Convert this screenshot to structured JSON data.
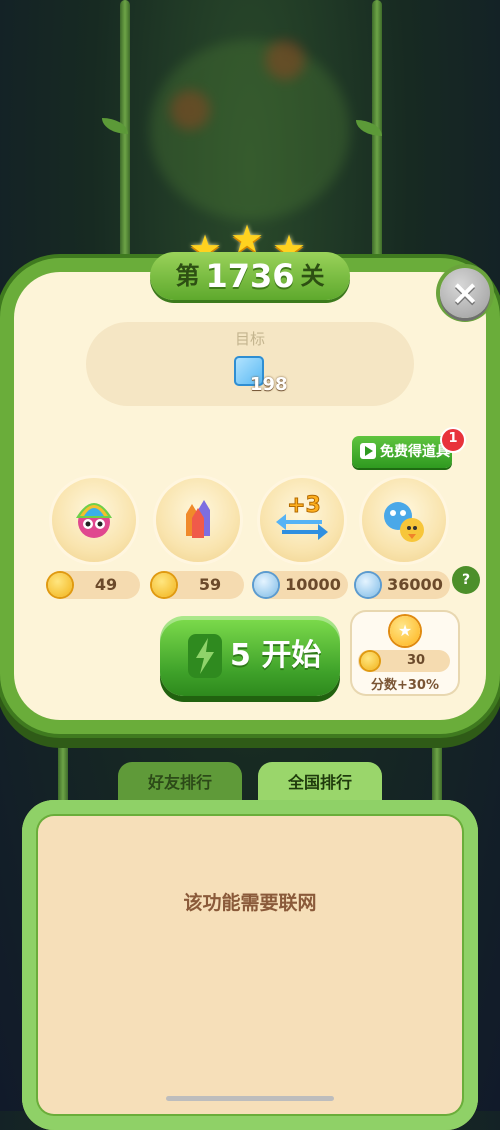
{
  "level": {
    "prefix": "第",
    "number": "1736",
    "suffix": "关",
    "stars": 3
  },
  "goal": {
    "label": "目标",
    "target_count": "198",
    "target_icon": "blue-block-icon"
  },
  "free_items": {
    "label": "免费得道具",
    "badge": "1"
  },
  "boosters": [
    {
      "name": "rainbow-owl",
      "icon": "rainbow-owl-icon",
      "currency": "coin",
      "price": "49"
    },
    {
      "name": "rockets",
      "icon": "rocket-icon",
      "currency": "coin",
      "price": "59"
    },
    {
      "name": "plus-moves",
      "icon": "plus-three-moves-icon",
      "icon_text": "+3",
      "currency": "gem",
      "price": "10000"
    },
    {
      "name": "critter-swap",
      "icon": "critter-icon",
      "currency": "gem",
      "price": "36000"
    }
  ],
  "start_button": {
    "lives": "5",
    "label": "开始"
  },
  "score_bonus": {
    "price": "30",
    "label": "分数+30%"
  },
  "help_label": "?",
  "close_label": "×",
  "leaderboard": {
    "tabs": [
      {
        "label": "好友排行",
        "active": false
      },
      {
        "label": "全国排行",
        "active": true
      }
    ],
    "message": "该功能需要联网"
  },
  "colors": {
    "panel": "#fdf4d8",
    "frame_green": "#6aad3a",
    "start_green": "#3fa22a",
    "badge_red": "#e8333b"
  }
}
